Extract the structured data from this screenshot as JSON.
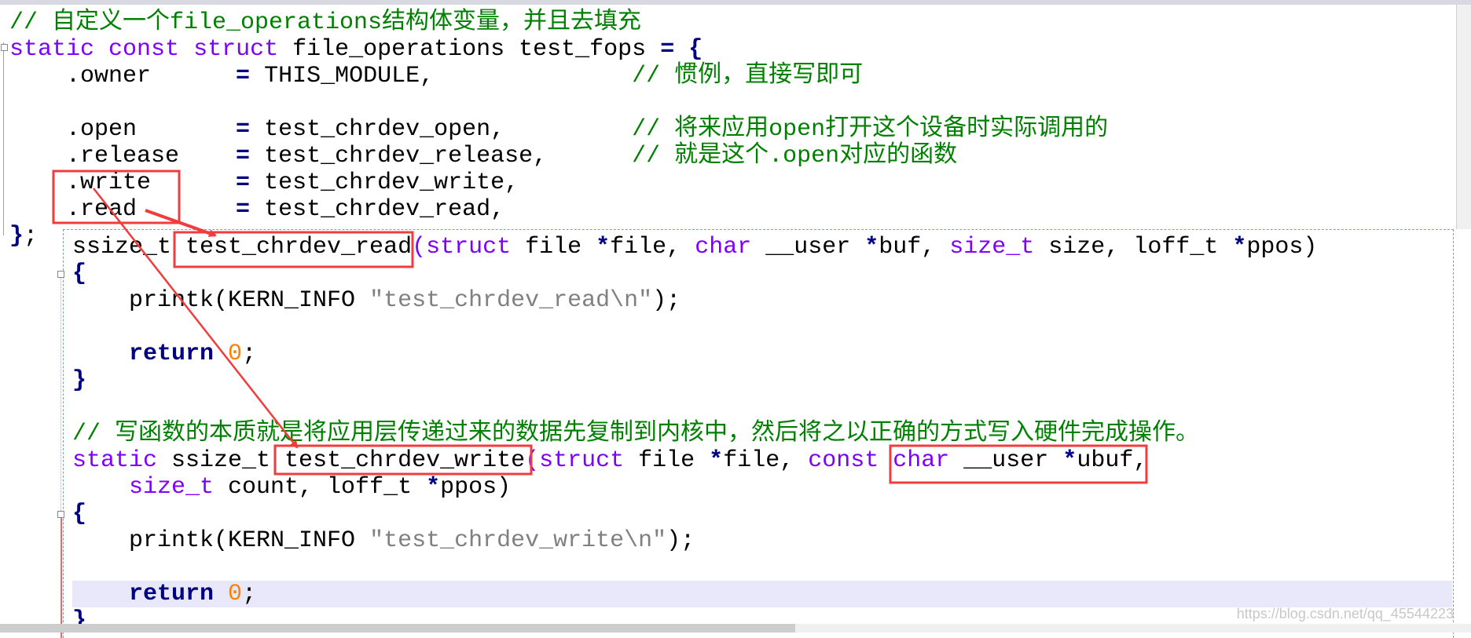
{
  "colors": {
    "keyword": "#8000ff",
    "comment": "#008000",
    "string": "#808080",
    "number": "#ff8000",
    "operator": "#000080",
    "annotation": "#f03c3c",
    "current_line": "#e8e8fa"
  },
  "main_code": [
    [
      [
        "c",
        "// 自定义一个file_operations结构体变量，并且去填充"
      ]
    ],
    [
      [
        "k",
        "static"
      ],
      [
        "p",
        " "
      ],
      [
        "k",
        "const"
      ],
      [
        "p",
        " "
      ],
      [
        "k",
        "struct"
      ],
      [
        "p",
        " file_operations test_fops "
      ],
      [
        "o",
        "="
      ],
      [
        "p",
        " "
      ],
      [
        "o",
        "{"
      ]
    ],
    [
      [
        "p",
        "    .owner      "
      ],
      [
        "o",
        "="
      ],
      [
        "p",
        " THIS_MODULE,              "
      ],
      [
        "c",
        "// 惯例，直接写即可"
      ]
    ],
    [],
    [
      [
        "p",
        "    .open       "
      ],
      [
        "o",
        "="
      ],
      [
        "p",
        " test_chrdev_open,         "
      ],
      [
        "c",
        "// 将来应用open打开这个设备时实际调用的"
      ]
    ],
    [
      [
        "p",
        "    .release    "
      ],
      [
        "o",
        "="
      ],
      [
        "p",
        " test_chrdev_release,      "
      ],
      [
        "c",
        "// 就是这个.open对应的函数"
      ]
    ],
    [
      [
        "p",
        "    .write      "
      ],
      [
        "o",
        "="
      ],
      [
        "p",
        " test_chrdev_write,"
      ]
    ],
    [
      [
        "p",
        "    .read       "
      ],
      [
        "o",
        "="
      ],
      [
        "p",
        " test_chrdev_read,"
      ]
    ],
    [
      [
        "o",
        "}"
      ],
      [
        "p",
        ";"
      ]
    ]
  ],
  "popup_code": [
    [
      [
        "p",
        "ssize_t test_chrdev_read"
      ],
      [
        "k",
        "(struct"
      ],
      [
        "p",
        " file "
      ],
      [
        "o",
        "*"
      ],
      [
        "p",
        "file, "
      ],
      [
        "k",
        "char"
      ],
      [
        "p",
        " __user "
      ],
      [
        "o",
        "*"
      ],
      [
        "p",
        "buf, "
      ],
      [
        "k",
        "size_t"
      ],
      [
        "p",
        " size, loff_t "
      ],
      [
        "o",
        "*"
      ],
      [
        "p",
        "ppos)"
      ]
    ],
    [
      [
        "o",
        "{"
      ]
    ],
    [
      [
        "p",
        "    printk(KERN_INFO "
      ],
      [
        "s",
        "\"test_chrdev_read\\n\""
      ],
      [
        "p",
        ");"
      ]
    ],
    [],
    [
      [
        "o",
        "    return"
      ],
      [
        "p",
        " "
      ],
      [
        "n",
        "0"
      ],
      [
        "p",
        ";"
      ]
    ],
    [
      [
        "o",
        "}"
      ]
    ],
    [],
    [
      [
        "c",
        "// 写函数的本质就是将应用层传递过来的数据先复制到内核中，然后将之以正确的方式写入硬件完成操作。"
      ]
    ],
    [
      [
        "k",
        "static"
      ],
      [
        "p",
        " ssize_t test_chrdev_write"
      ],
      [
        "k",
        "(struct"
      ],
      [
        "p",
        " file "
      ],
      [
        "o",
        "*"
      ],
      [
        "p",
        "file, "
      ],
      [
        "k",
        "const"
      ],
      [
        "p",
        " "
      ],
      [
        "k",
        "char"
      ],
      [
        "p",
        " __user "
      ],
      [
        "o",
        "*"
      ],
      [
        "p",
        "ubuf,"
      ]
    ],
    [
      [
        "k",
        "    size_t"
      ],
      [
        "p",
        " count, loff_t "
      ],
      [
        "o",
        "*"
      ],
      [
        "p",
        "ppos)"
      ]
    ],
    [
      [
        "o",
        "{"
      ]
    ],
    [
      [
        "p",
        "    printk(KERN_INFO "
      ],
      [
        "s",
        "\"test_chrdev_write\\n\""
      ],
      [
        "p",
        ");"
      ]
    ],
    [],
    [
      [
        "o",
        "    return"
      ],
      [
        "p",
        " "
      ],
      [
        "n",
        "0"
      ],
      [
        "p",
        ";"
      ]
    ],
    [
      [
        "o",
        "}"
      ]
    ]
  ],
  "watermark": "https://blog.csdn.net/qq_45544223"
}
